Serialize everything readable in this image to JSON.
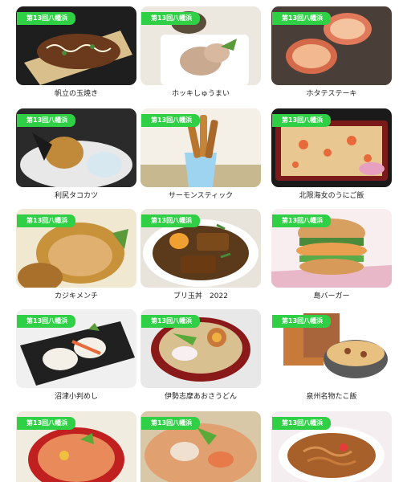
{
  "badge_text": "第13回八幡浜",
  "items": [
    {
      "name": "帆立の玉焼き",
      "icon": "food-photo"
    },
    {
      "name": "ホッキしゅうまい",
      "icon": "food-photo"
    },
    {
      "name": "ホタテステーキ",
      "icon": "food-photo"
    },
    {
      "name": "利尻タコカツ",
      "icon": "food-photo"
    },
    {
      "name": "サーモンスティック",
      "icon": "food-photo"
    },
    {
      "name": "北限海女のうにご飯",
      "icon": "food-photo"
    },
    {
      "name": "カジキメンチ",
      "icon": "food-photo"
    },
    {
      "name": "ブリ玉丼　2022",
      "icon": "food-photo"
    },
    {
      "name": "島バーガー",
      "icon": "food-photo"
    },
    {
      "name": "沼津小判めし",
      "icon": "food-photo"
    },
    {
      "name": "伊勢志摩あおさうどん",
      "icon": "food-photo"
    },
    {
      "name": "泉州名物たこ飯",
      "icon": "food-photo"
    },
    {
      "name": "",
      "icon": "food-photo"
    },
    {
      "name": "",
      "icon": "food-photo"
    },
    {
      "name": "",
      "icon": "food-photo"
    }
  ]
}
